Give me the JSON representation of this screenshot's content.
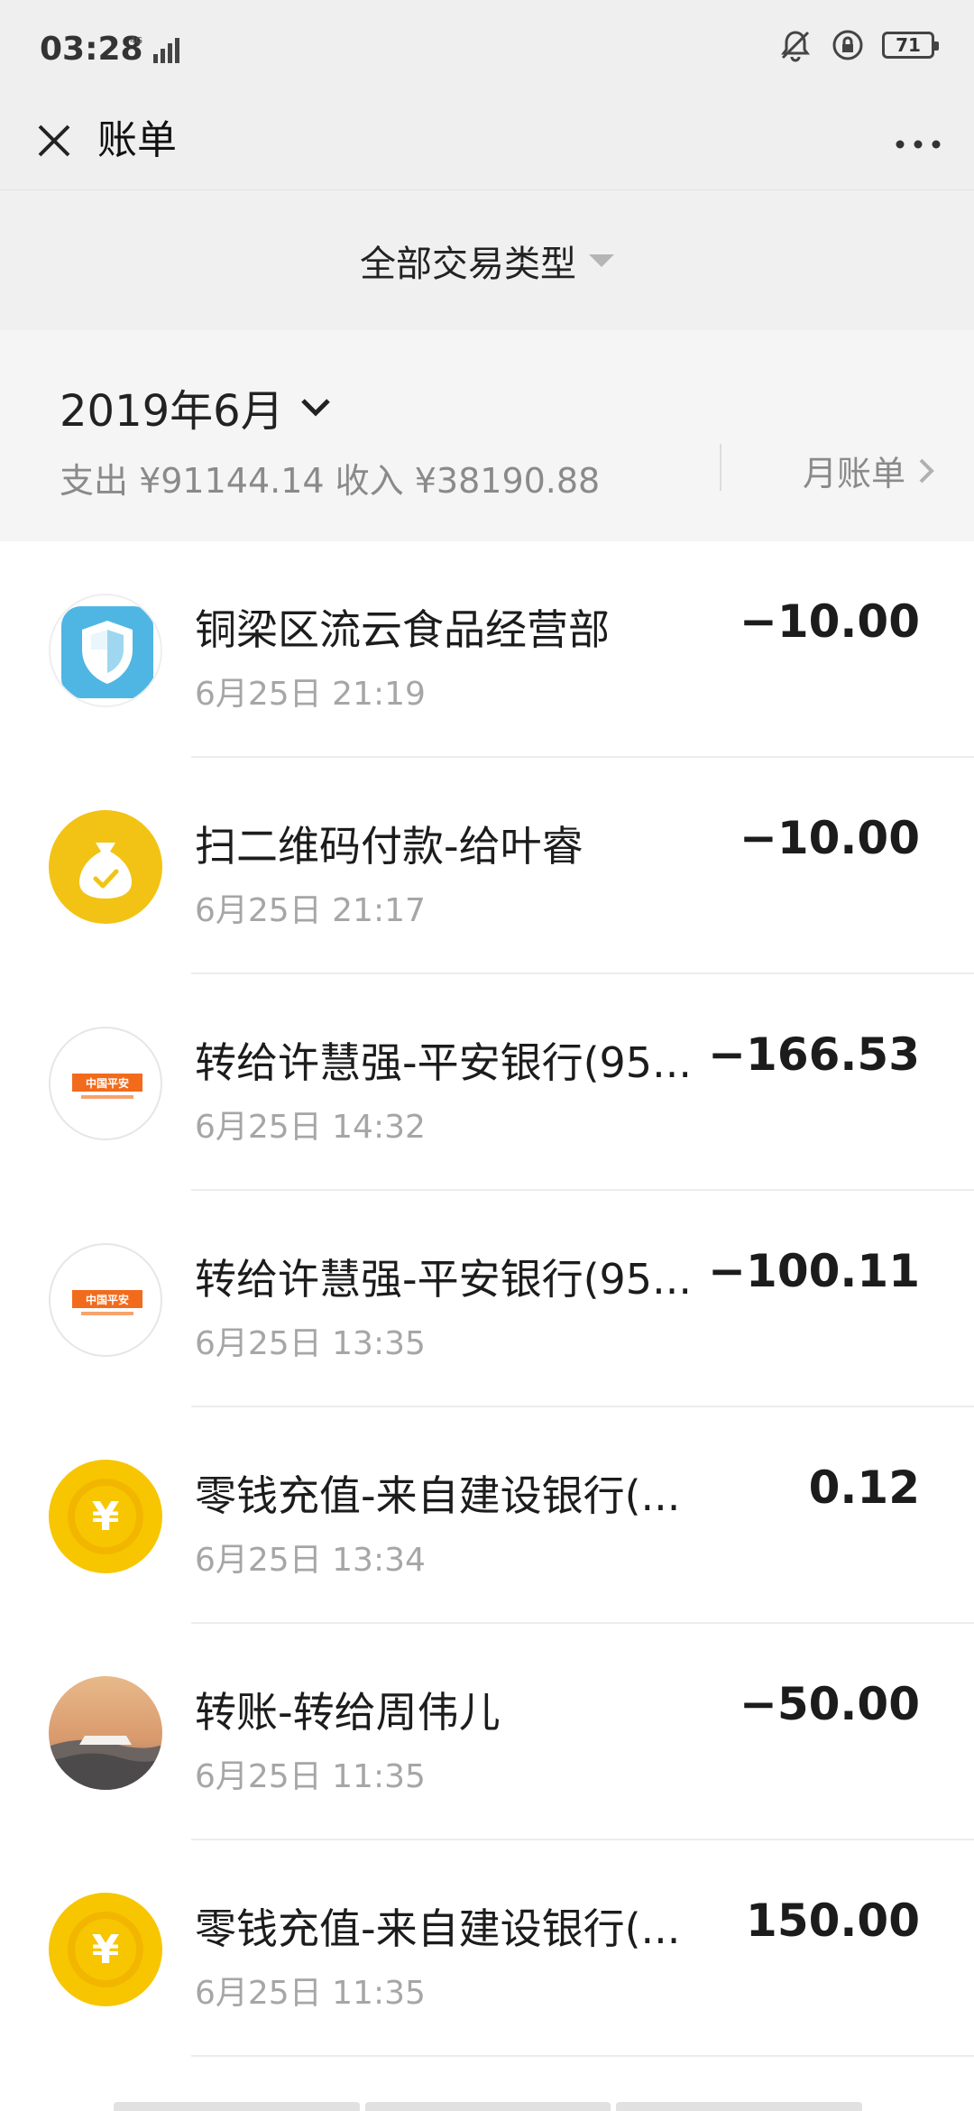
{
  "status": {
    "time": "03:28",
    "network": "4G",
    "battery": "71"
  },
  "header": {
    "title": "账单"
  },
  "filter": {
    "label": "全部交易类型"
  },
  "summary": {
    "month": "2019年6月",
    "totals": "支出 ¥91144.14 收入 ¥38190.88",
    "monthly_bill": "月账单"
  },
  "transactions": [
    {
      "title": "铜梁区流云食品经营部",
      "time": "6月25日 21:19",
      "amount": "−10.00",
      "icon": "shield-icon"
    },
    {
      "title": "扫二维码付款-给叶睿",
      "time": "6月25日 21:17",
      "amount": "−10.00",
      "icon": "money-bag-icon"
    },
    {
      "title": "转给许慧强-平安银行(95...",
      "time": "6月25日 14:32",
      "amount": "−166.53",
      "icon": "pingan-bank-icon"
    },
    {
      "title": "转给许慧强-平安银行(95...",
      "time": "6月25日 13:35",
      "amount": "−100.11",
      "icon": "pingan-bank-icon"
    },
    {
      "title": "零钱充值-来自建设银行(...",
      "time": "6月25日 13:34",
      "amount": "0.12",
      "icon": "yuan-coin-icon"
    },
    {
      "title": "转账-转给周伟儿",
      "time": "6月25日 11:35",
      "amount": "−50.00",
      "icon": "user-photo-avatar"
    },
    {
      "title": "零钱充值-来自建设银行(...",
      "time": "6月25日 11:35",
      "amount": "150.00",
      "icon": "yuan-coin-icon"
    }
  ],
  "bank_logo_text": "中国平安",
  "colors": {
    "gold": "#f2c314",
    "shield_blue": "#4fb6e3",
    "pingan_orange": "#f26b1d"
  }
}
